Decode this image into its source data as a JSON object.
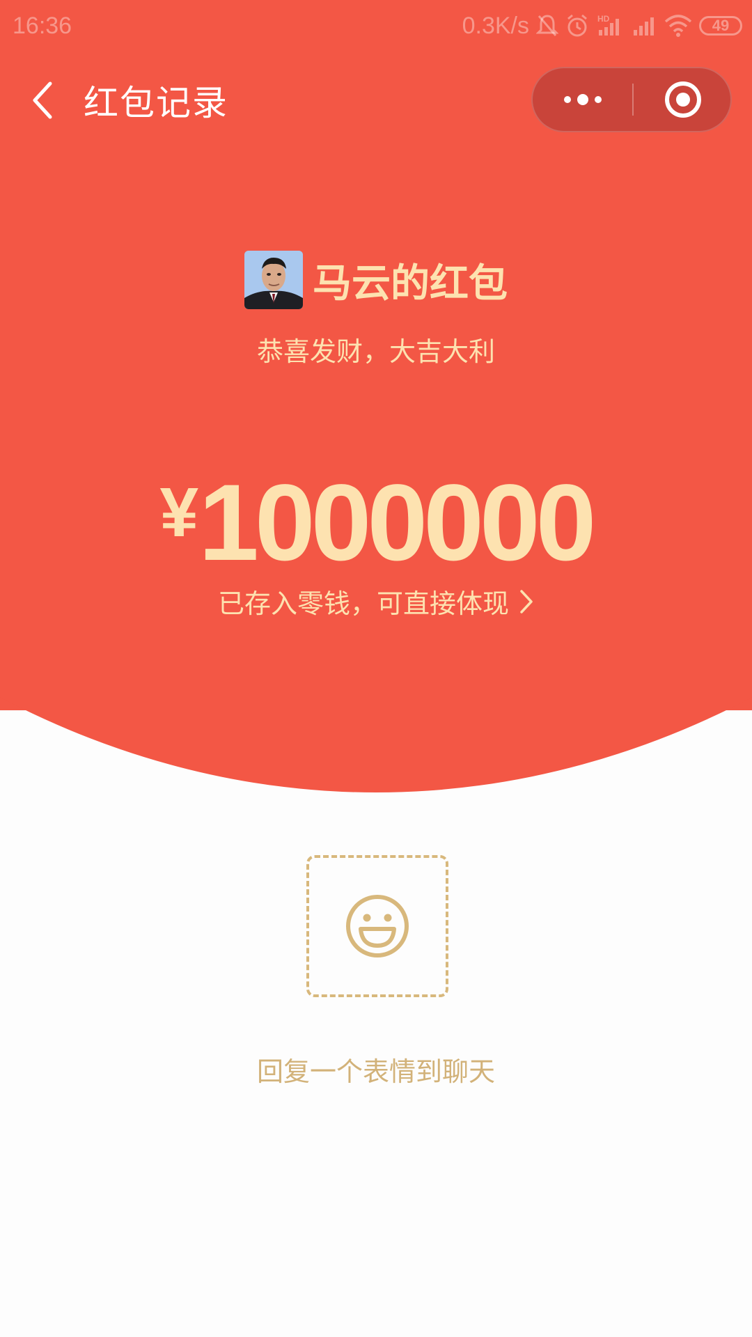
{
  "status_bar": {
    "time": "16:36",
    "net_speed": "0.3K/s",
    "battery": "49",
    "icons": [
      "mute-bell-icon",
      "alarm-icon",
      "hd-signal-icon",
      "signal-icon",
      "wifi-icon",
      "battery-icon"
    ]
  },
  "nav": {
    "back_icon": "chevron-left-icon",
    "title": "红包记录",
    "more_icon": "more-dots-icon",
    "close_icon": "target-close-icon"
  },
  "packet": {
    "sender_name": "马云的红包",
    "greeting": "恭喜发财，大吉大利",
    "currency": "¥",
    "amount": "1000000",
    "deposit_note": "已存入零钱，可直接体现"
  },
  "reply": {
    "emoji_icon": "smiley-icon",
    "label": "回复一个表情到聊天"
  },
  "colors": {
    "red": "#f35745",
    "gold": "#fde2b0",
    "dashed_gold": "#d8b87c"
  }
}
